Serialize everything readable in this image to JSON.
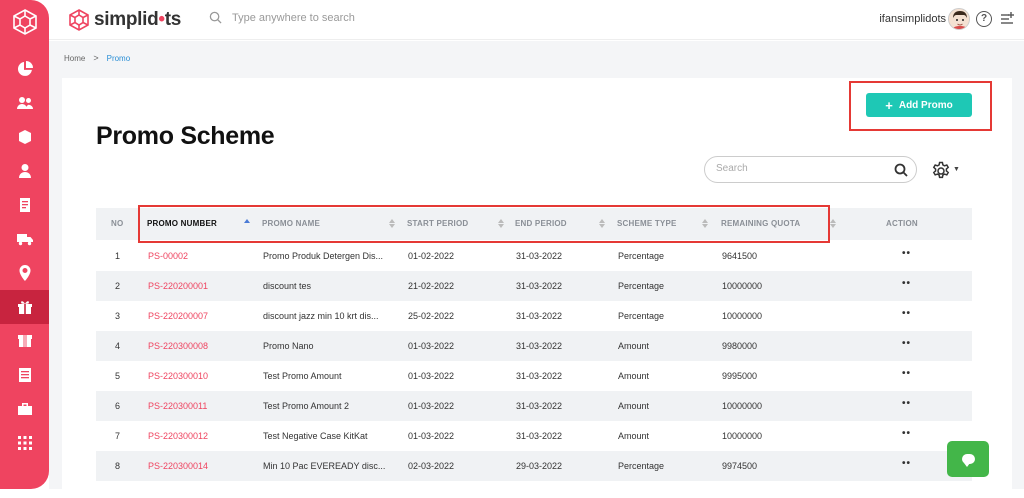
{
  "brand": {
    "name_prefix": "simplid",
    "name_dot": "•",
    "name_suffix": "ts"
  },
  "topbar": {
    "search_placeholder": "Type anywhere to search",
    "user_name": "ifansimplidots",
    "help": "?"
  },
  "breadcrumb": {
    "home": "Home",
    "separator": ">",
    "current": "Promo"
  },
  "page": {
    "title": "Promo Scheme",
    "add_button": "Add Promo",
    "add_icon": "+",
    "search_placeholder": "Search"
  },
  "table": {
    "headers": {
      "no": "NO",
      "promo_number": "PROMO NUMBER",
      "promo_name": "PROMO NAME",
      "start_period": "START PERIOD",
      "end_period": "END PERIOD",
      "scheme_type": "SCHEME TYPE",
      "remaining_quota": "REMAINING QUOTA",
      "action": "ACTION"
    },
    "sorted_column": "promo_number",
    "rows": [
      {
        "no": "1",
        "promo_number": "PS-00002",
        "promo_name": "Promo Produk Detergen Dis...",
        "start": "01-02-2022",
        "end": "31-03-2022",
        "type": "Percentage",
        "quota": "9641500",
        "action": "••"
      },
      {
        "no": "2",
        "promo_number": "PS-220200001",
        "promo_name": "discount tes",
        "start": "21-02-2022",
        "end": "31-03-2022",
        "type": "Percentage",
        "quota": "10000000",
        "action": "••"
      },
      {
        "no": "3",
        "promo_number": "PS-220200007",
        "promo_name": "discount jazz min 10 krt dis...",
        "start": "25-02-2022",
        "end": "31-03-2022",
        "type": "Percentage",
        "quota": "10000000",
        "action": "••"
      },
      {
        "no": "4",
        "promo_number": "PS-220300008",
        "promo_name": "Promo Nano",
        "start": "01-03-2022",
        "end": "31-03-2022",
        "type": "Amount",
        "quota": "9980000",
        "action": "••"
      },
      {
        "no": "5",
        "promo_number": "PS-220300010",
        "promo_name": "Test Promo Amount",
        "start": "01-03-2022",
        "end": "31-03-2022",
        "type": "Amount",
        "quota": "9995000",
        "action": "••"
      },
      {
        "no": "6",
        "promo_number": "PS-220300011",
        "promo_name": "Test Promo Amount 2",
        "start": "01-03-2022",
        "end": "31-03-2022",
        "type": "Amount",
        "quota": "10000000",
        "action": "••"
      },
      {
        "no": "7",
        "promo_number": "PS-220300012",
        "promo_name": "Test Negative Case KitKat",
        "start": "01-03-2022",
        "end": "31-03-2022",
        "type": "Amount",
        "quota": "10000000",
        "action": "••"
      },
      {
        "no": "8",
        "promo_number": "PS-220300014",
        "promo_name": "Min 10 Pac EVEREADY disc...",
        "start": "02-03-2022",
        "end": "29-03-2022",
        "type": "Percentage",
        "quota": "9974500",
        "action": "••"
      }
    ]
  },
  "colors": {
    "sidebar": "#ef4460",
    "sidebar_active": "#c8243f",
    "accent": "#1ec8b5",
    "promo_link": "#ef4460",
    "highlight": "#e53935",
    "chat": "#43b649"
  },
  "sidebar_icons": [
    "dashboard-icon",
    "users-icon",
    "box-icon",
    "person-icon",
    "document-icon",
    "truck-icon",
    "location-icon",
    "gift-icon",
    "package-icon",
    "list-icon",
    "briefcase-icon",
    "grid-icon"
  ],
  "sidebar_active_icon": "gift-icon"
}
